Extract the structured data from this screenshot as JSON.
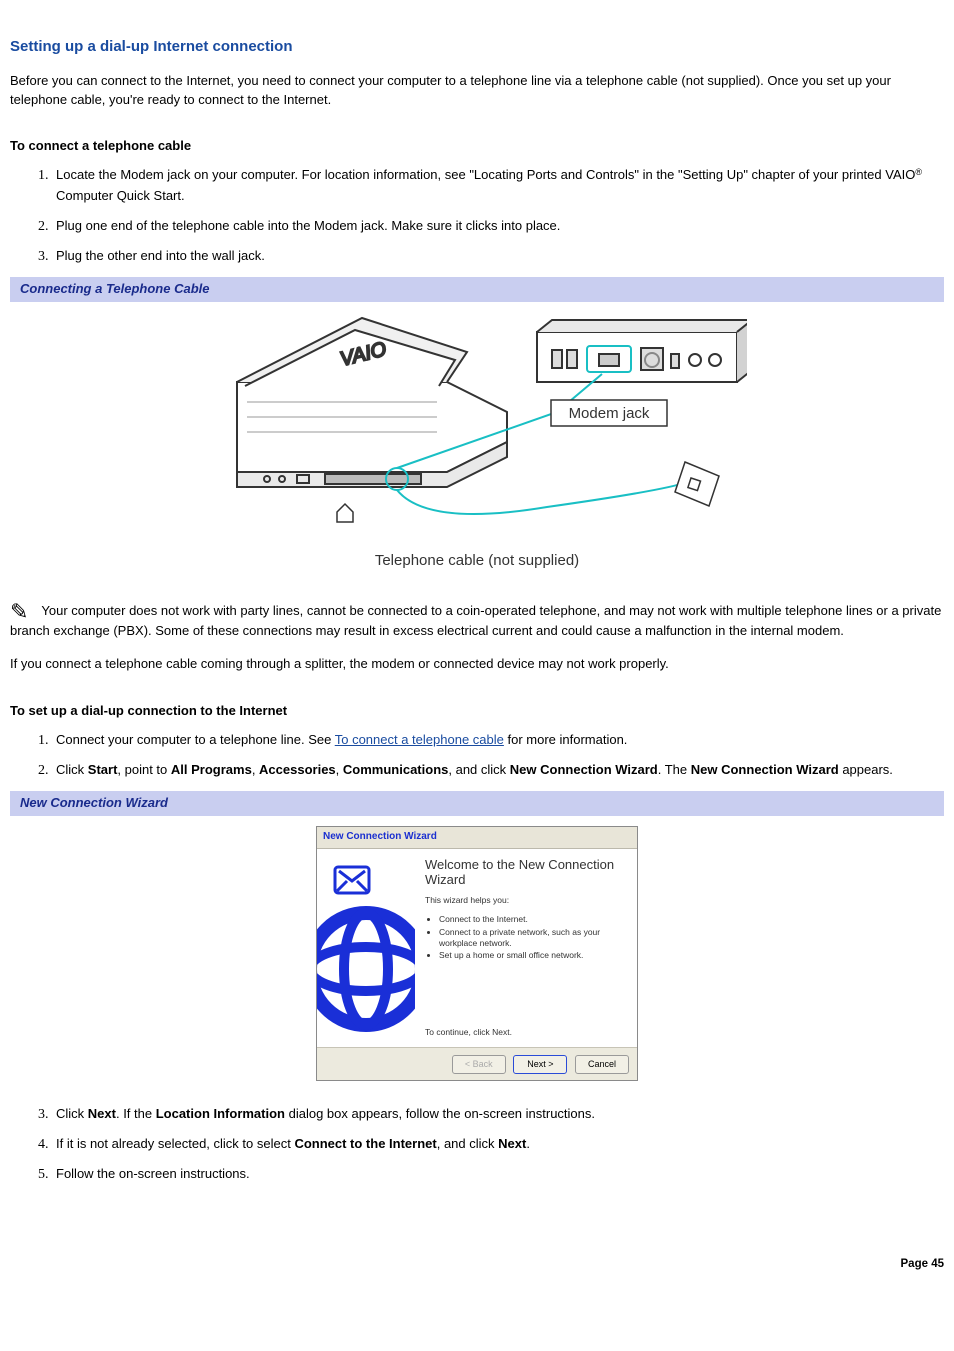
{
  "title": "Setting up a dial-up Internet connection",
  "intro": "Before you can connect to the Internet, you need to connect your computer to a telephone line via a telephone cable (not supplied). Once you set up your telephone cable, you're ready to connect to the Internet.",
  "sec1": {
    "heading": "To connect a telephone cable",
    "steps": {
      "s1a": "Locate the Modem jack on your computer. For location information, see \"Locating Ports and Controls\" in the \"Setting Up\" chapter of your printed VAIO",
      "s1b": " Computer Quick Start.",
      "s2": "Plug one end of the telephone cable into the Modem jack. Make sure it clicks into place.",
      "s3": "Plug the other end into the wall jack."
    }
  },
  "fig1": {
    "bar": "Connecting a Telephone Cable",
    "label_modem": "Modem jack",
    "caption": "Telephone cable (not supplied)"
  },
  "note1": "Your computer does not work with party lines, cannot be connected to a coin-operated telephone, and may not work with multiple telephone lines or a private branch exchange (PBX). Some of these connections may result in excess electrical current and could cause a malfunction in the internal modem.",
  "note2": "If you connect a telephone cable coming through a splitter, the modem or connected device may not work properly.",
  "sec2": {
    "heading": "To set up a dial-up connection to the Internet",
    "s1a": "Connect your computer to a telephone line. See ",
    "s1link": "To connect a telephone cable",
    "s1b": " for more information.",
    "s2a": "Click ",
    "s2_start": "Start",
    "s2b": ", point to ",
    "s2_allprog": "All Programs",
    "s2c": ", ",
    "s2_acc": "Accessories",
    "s2d": ", ",
    "s2_comm": "Communications",
    "s2e": ", and click ",
    "s2_ncw": "New Connection Wizard",
    "s2f": ". The ",
    "s2_ncw2": "New Connection Wizard",
    "s2g": " appears.",
    "s3a": "Click ",
    "s3_next": "Next",
    "s3b": ". If the ",
    "s3_loc": "Location Information",
    "s3c": " dialog box appears, follow the on-screen instructions.",
    "s4a": "If it is not already selected, click to select ",
    "s4_conn": "Connect to the Internet",
    "s4b": ", and click ",
    "s4_next": "Next",
    "s4c": ".",
    "s5": "Follow the on-screen instructions."
  },
  "fig2": {
    "bar": "New Connection Wizard",
    "titlebar": "New Connection Wizard",
    "welcome": "Welcome to the New Connection Wizard",
    "helps": "This wizard helps you:",
    "b1": "Connect to the Internet.",
    "b2": "Connect to a private network, such as your workplace network.",
    "b3": "Set up a home or small office network.",
    "continue": "To continue, click Next.",
    "btn_back": "< Back",
    "btn_next": "Next >",
    "btn_cancel": "Cancel"
  },
  "page_number": "Page 45"
}
